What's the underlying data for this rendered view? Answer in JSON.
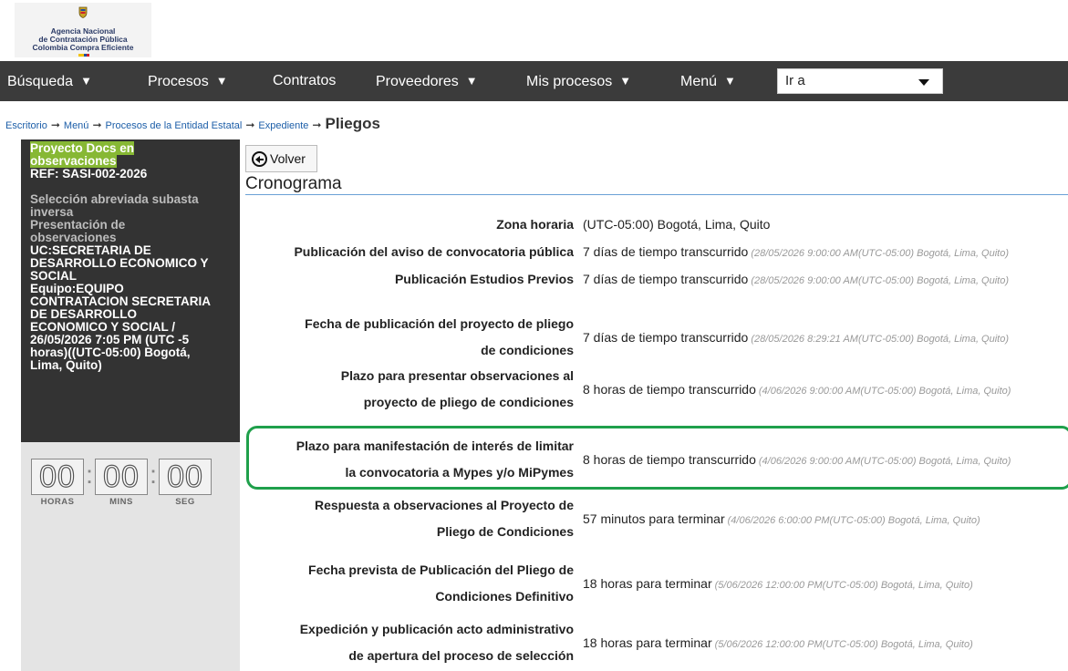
{
  "logo": {
    "line1": "Agencia Nacional",
    "line2": "de Contratación Pública",
    "line3": "Colombia Compra Eficiente"
  },
  "navbar": {
    "items": [
      {
        "label": "Búsqueda",
        "has_caret": true
      },
      {
        "label": "Procesos",
        "has_caret": true
      },
      {
        "label": "Contratos",
        "has_caret": false
      },
      {
        "label": "Proveedores",
        "has_caret": true
      },
      {
        "label": "Mis procesos",
        "has_caret": true
      },
      {
        "label": "Menú",
        "has_caret": true
      }
    ],
    "goto_select": "Ir a"
  },
  "breadcrumb": {
    "items": [
      "Escritorio",
      "Menú",
      "Procesos de la Entidad Estatal",
      "Expediente"
    ],
    "current": "Pliegos"
  },
  "sidebar": {
    "status_line1": "Proyecto Docs en",
    "status_line2": "observaciones",
    "ref": "REF: SASI-002-2026",
    "modality_line1": "Selección abreviada subasta",
    "modality_line2": "inversa",
    "phase_line1": "Presentación de",
    "phase_line2": "observaciones",
    "uc_lines": [
      "UC:SECRETARIA DE",
      "DESARROLLO ECONOMICO Y",
      "SOCIAL",
      "Equipo:EQUIPO",
      "CONTRATACION SECRETARIA",
      "DE DESARROLLO",
      "ECONOMICO Y SOCIAL /",
      "26/05/2026 7:05 PM (UTC -5",
      "horas)((UTC-05:00) Bogotá,",
      "Lima, Quito)"
    ],
    "timer": {
      "hours": "00",
      "mins": "00",
      "secs": "00",
      "hours_label": "HORAS",
      "mins_label": "MINS",
      "secs_label": "SEG"
    }
  },
  "main": {
    "back_label": "Volver",
    "section_title": "Cronograma",
    "schedule": [
      {
        "label_lines": [
          "Zona horaria"
        ],
        "value": "(UTC-05:00) Bogotá, Lima, Quito",
        "note": ""
      },
      {
        "label_lines": [
          "Publicación del aviso de convocatoria pública"
        ],
        "value": "7 días de tiempo transcurrido",
        "note": "(28/05/2026 9:00:00 AM(UTC-05:00) Bogotá, Lima, Quito)"
      },
      {
        "label_lines": [
          "Publicación Estudios Previos"
        ],
        "value": "7 días de tiempo transcurrido",
        "note": "(28/05/2026 9:00:00 AM(UTC-05:00) Bogotá, Lima, Quito)"
      },
      {
        "label_lines": [
          "Fecha de publicación del proyecto de pliego",
          "de condiciones"
        ],
        "value": "7 días de tiempo transcurrido",
        "note": "(28/05/2026 8:29:21 AM(UTC-05:00) Bogotá, Lima, Quito)"
      },
      {
        "label_lines": [
          "Plazo para presentar observaciones al",
          "proyecto de pliego de condiciones"
        ],
        "value": "8 horas de tiempo transcurrido",
        "note": "(4/06/2026 9:00:00 AM(UTC-05:00) Bogotá, Lima, Quito)"
      },
      {
        "label_lines": [
          "Plazo para manifestación de interés de limitar",
          "la convocatoria a Mypes y/o MiPymes"
        ],
        "value": "8 horas de tiempo transcurrido",
        "note": "(4/06/2026 9:00:00 AM(UTC-05:00) Bogotá, Lima, Quito)"
      },
      {
        "label_lines": [
          "Respuesta a observaciones al Proyecto de",
          "Pliego de Condiciones"
        ],
        "value": "57 minutos para terminar",
        "note": "(4/06/2026 6:00:00 PM(UTC-05:00) Bogotá, Lima, Quito)"
      },
      {
        "label_lines": [
          "Fecha prevista de Publicación del Pliego de",
          "Condiciones Definitivo"
        ],
        "value": "18 horas para terminar",
        "note": "(5/06/2026 12:00:00 PM(UTC-05:00) Bogotá, Lima, Quito)"
      },
      {
        "label_lines": [
          "Expedición y publicación acto administrativo",
          "de apertura del proceso de selección"
        ],
        "value": "18 horas para terminar",
        "note": "(5/06/2026 12:00:00 PM(UTC-05:00) Bogotá, Lima, Quito)"
      }
    ]
  },
  "colors": {
    "navbar_bg": "#3b3b3b",
    "highlight_green": "#1fa04b",
    "status_tag_green": "#87b834",
    "link_blue": "#1c5ea8"
  }
}
